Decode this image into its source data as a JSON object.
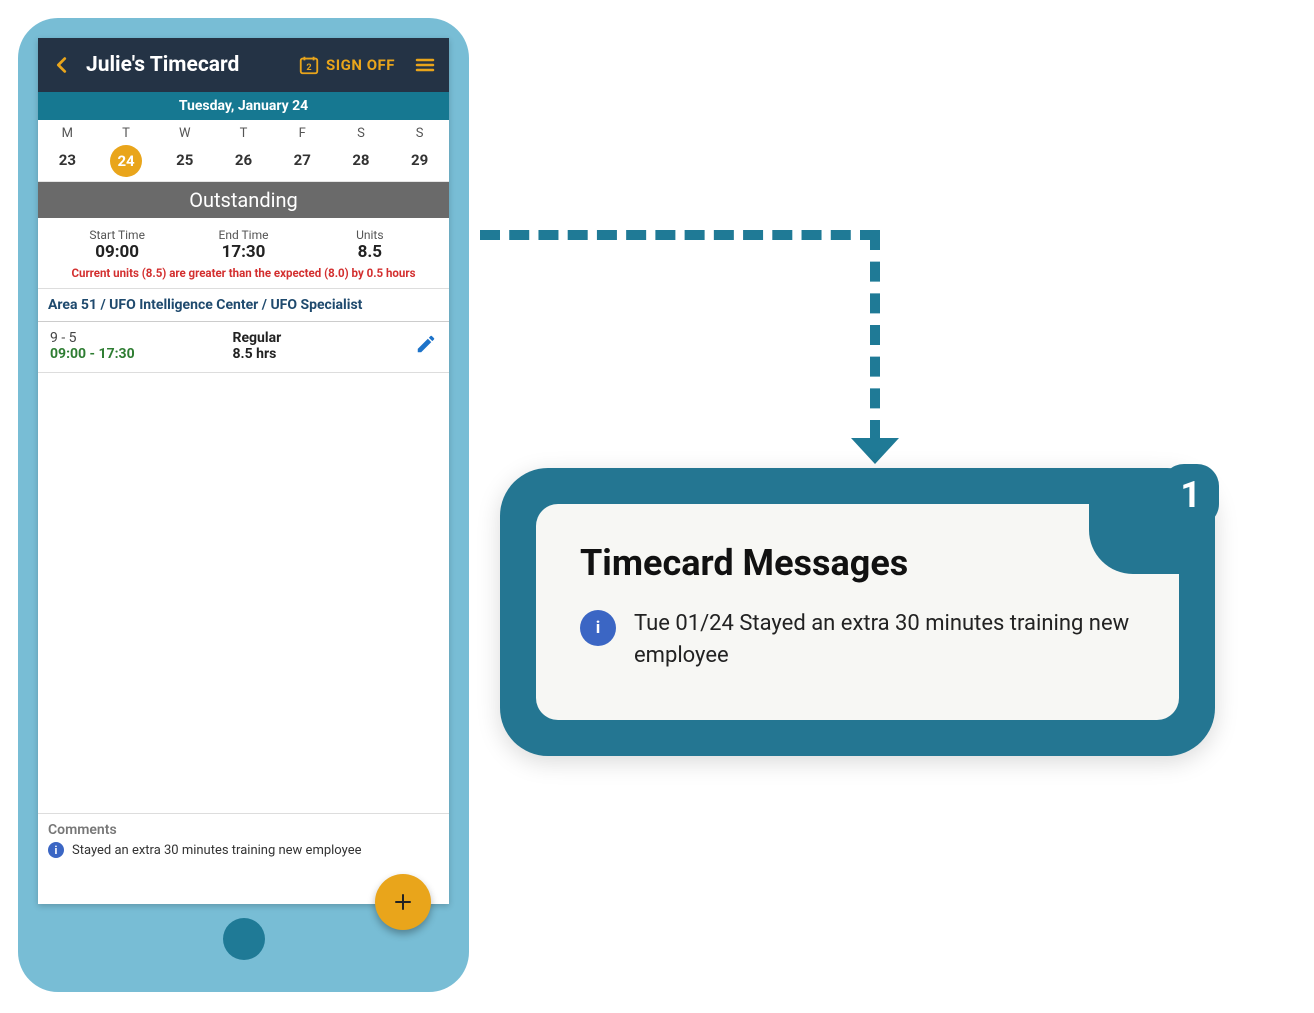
{
  "header": {
    "title": "Julie's Timecard",
    "signoff": "SIGN OFF",
    "calendar_day": "2"
  },
  "date_bar": "Tuesday, January 24",
  "week": {
    "headers": [
      "M",
      "T",
      "W",
      "T",
      "F",
      "S",
      "S"
    ],
    "days": [
      "23",
      "24",
      "25",
      "26",
      "27",
      "28",
      "29"
    ],
    "selected_index": 1
  },
  "status": "Outstanding",
  "summary": {
    "start_label": "Start Time",
    "start_value": "09:00",
    "end_label": "End Time",
    "end_value": "17:30",
    "units_label": "Units",
    "units_value": "8.5",
    "warning": "Current units (8.5) are greater than the expected (8.0) by 0.5 hours"
  },
  "job": "Area 51 / UFO Intelligence Center / UFO Specialist",
  "shift": {
    "scheduled": "9 - 5",
    "actual": "09:00 - 17:30",
    "type": "Regular",
    "hours": "8.5 hrs"
  },
  "comments": {
    "heading": "Comments",
    "text": "Stayed an extra 30 minutes training new employee"
  },
  "callout": {
    "step": "1",
    "title": "Timecard Messages",
    "message": "Tue 01/24 Stayed an extra 30 minutes training new employee"
  }
}
